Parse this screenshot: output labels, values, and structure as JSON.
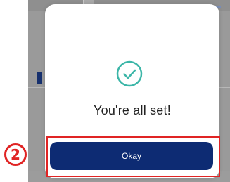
{
  "modal": {
    "message": "You're all set!",
    "icon": "check-circle-icon"
  },
  "actions": {
    "okay_label": "Okay"
  },
  "annotation": {
    "step_number": "2"
  },
  "colors": {
    "primary_button": "#0d2b73",
    "success_accent": "#3cb6a8",
    "highlight": "#e02424"
  }
}
